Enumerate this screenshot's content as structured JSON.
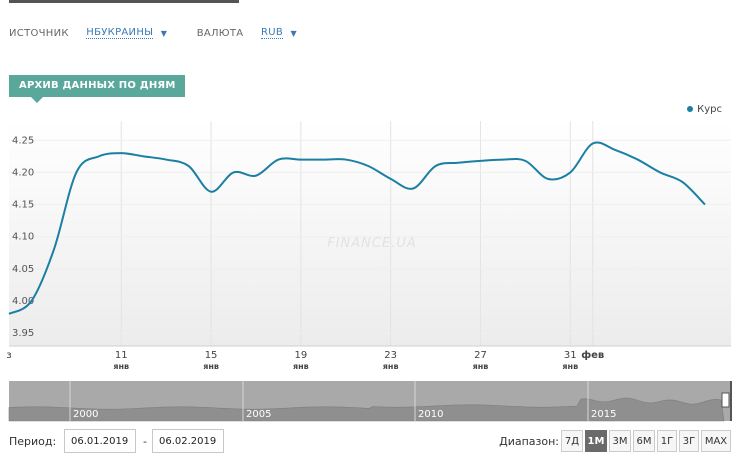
{
  "filters": {
    "source_label": "ИСТОЧНИК",
    "source_value": "НБУКРАИНЫ",
    "currency_label": "ВАЛЮТА",
    "currency_value": "RUB"
  },
  "section": {
    "title": "АРХИВ ДАННЫХ ПО ДНЯМ"
  },
  "legend": {
    "series": "Курс"
  },
  "watermark": "FINANCE.UA",
  "chart_data": {
    "type": "line",
    "series": [
      {
        "name": "Курс",
        "color": "#1a7fa3",
        "x": [
          "2019-01-06",
          "2019-01-07",
          "2019-01-08",
          "2019-01-09",
          "2019-01-10",
          "2019-01-11",
          "2019-01-12",
          "2019-01-13",
          "2019-01-14",
          "2019-01-15",
          "2019-01-16",
          "2019-01-17",
          "2019-01-18",
          "2019-01-19",
          "2019-01-20",
          "2019-01-21",
          "2019-01-22",
          "2019-01-23",
          "2019-01-24",
          "2019-01-25",
          "2019-01-26",
          "2019-01-27",
          "2019-01-28",
          "2019-01-29",
          "2019-01-30",
          "2019-01-31",
          "2019-02-01",
          "2019-02-02",
          "2019-02-03",
          "2019-02-04",
          "2019-02-05",
          "2019-02-06"
        ],
        "values": [
          3.98,
          4.0,
          4.08,
          4.2,
          4.225,
          4.23,
          4.225,
          4.22,
          4.21,
          4.17,
          4.2,
          4.195,
          4.22,
          4.22,
          4.22,
          4.22,
          4.21,
          4.19,
          4.175,
          4.21,
          4.215,
          4.218,
          4.22,
          4.218,
          4.19,
          4.2,
          4.245,
          4.235,
          4.22,
          4.2,
          4.185,
          4.15
        ]
      }
    ],
    "y_ticks": [
      "3.95",
      "4.00",
      "4.05",
      "4.10",
      "4.15",
      "4.20",
      "4.25"
    ],
    "ylim": [
      3.93,
      4.28
    ],
    "x_ticks": [
      {
        "date": "2019-01-06",
        "label": "з",
        "sub": ""
      },
      {
        "date": "2019-01-11",
        "label": "11",
        "sub": "янв"
      },
      {
        "date": "2019-01-15",
        "label": "15",
        "sub": "янв"
      },
      {
        "date": "2019-01-19",
        "label": "19",
        "sub": "янв"
      },
      {
        "date": "2019-01-23",
        "label": "23",
        "sub": "янв"
      },
      {
        "date": "2019-01-27",
        "label": "27",
        "sub": "янв"
      },
      {
        "date": "2019-01-31",
        "label": "31",
        "sub": "янв"
      },
      {
        "date": "2019-02-01",
        "label": "фев",
        "sub": ""
      }
    ],
    "navigator_years": [
      "2000",
      "2005",
      "2010",
      "2015"
    ]
  },
  "period": {
    "label": "Период:",
    "from": "06.01.2019",
    "separator": "-",
    "to": "06.02.2019"
  },
  "range": {
    "label": "Диапазон:",
    "buttons": [
      "7Д",
      "1М",
      "3М",
      "6М",
      "1Г",
      "3Г",
      "MAX"
    ],
    "active": "1М"
  }
}
